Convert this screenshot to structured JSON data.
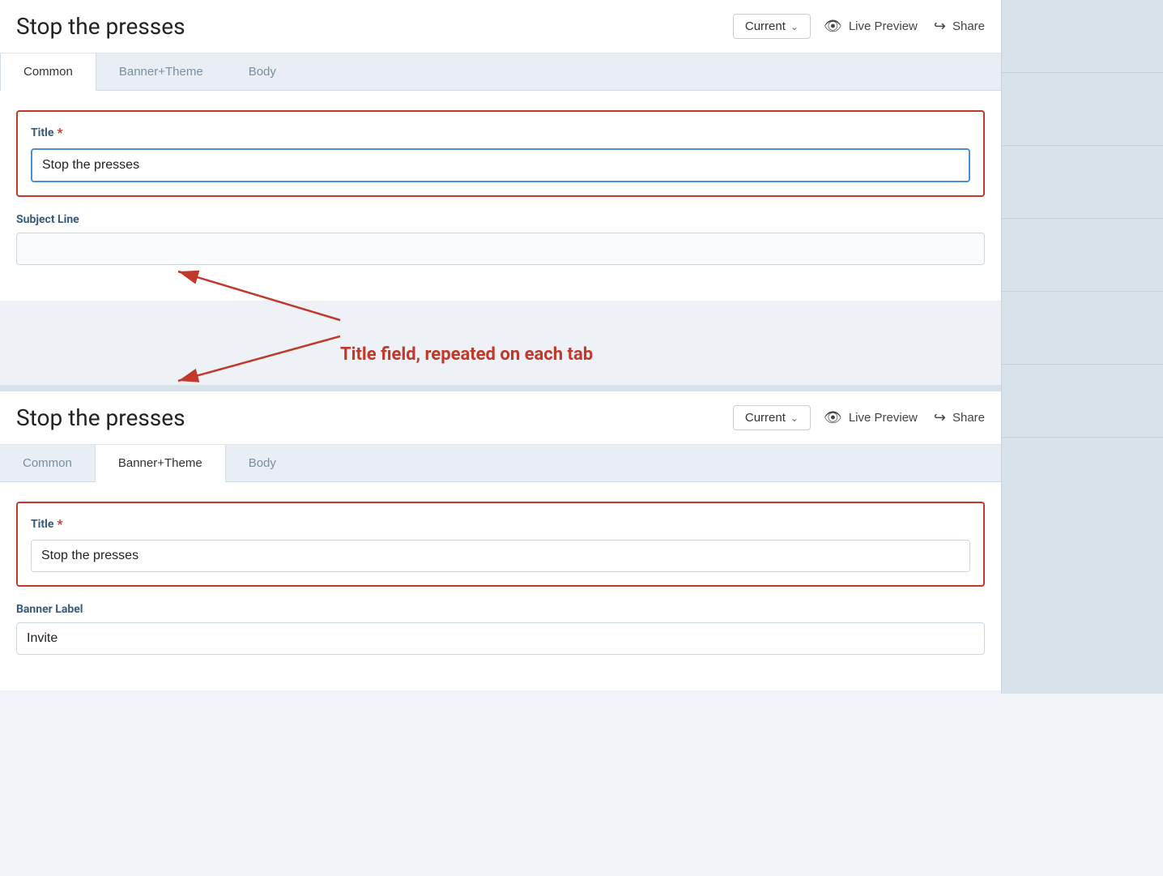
{
  "app": {
    "title": "Stop the presses"
  },
  "header": {
    "title": "Stop the presses",
    "dropdown_label": "Current",
    "live_preview_label": "Live Preview",
    "share_label": "Share"
  },
  "tabs_top": {
    "items": [
      {
        "id": "common",
        "label": "Common",
        "active": true
      },
      {
        "id": "banner_theme",
        "label": "Banner+Theme",
        "active": false
      },
      {
        "id": "body",
        "label": "Body",
        "active": false
      }
    ]
  },
  "tabs_bottom": {
    "items": [
      {
        "id": "common",
        "label": "Common",
        "active": false
      },
      {
        "id": "banner_theme",
        "label": "Banner+Theme",
        "active": true
      },
      {
        "id": "body",
        "label": "Body",
        "active": false
      }
    ]
  },
  "panel_top": {
    "title_field": {
      "label": "Title",
      "required": true,
      "value": "Stop the presses"
    },
    "subject_line_field": {
      "label": "Subject Line",
      "value": ""
    }
  },
  "panel_bottom": {
    "title_field": {
      "label": "Title",
      "required": true,
      "value": "Stop the presses"
    },
    "banner_label_field": {
      "label": "Banner Label",
      "value": "Invite"
    }
  },
  "annotation": {
    "text": "Title field, repeated on each tab"
  },
  "icons": {
    "eye": "👁",
    "share": "↪",
    "chevron_down": "∨"
  }
}
